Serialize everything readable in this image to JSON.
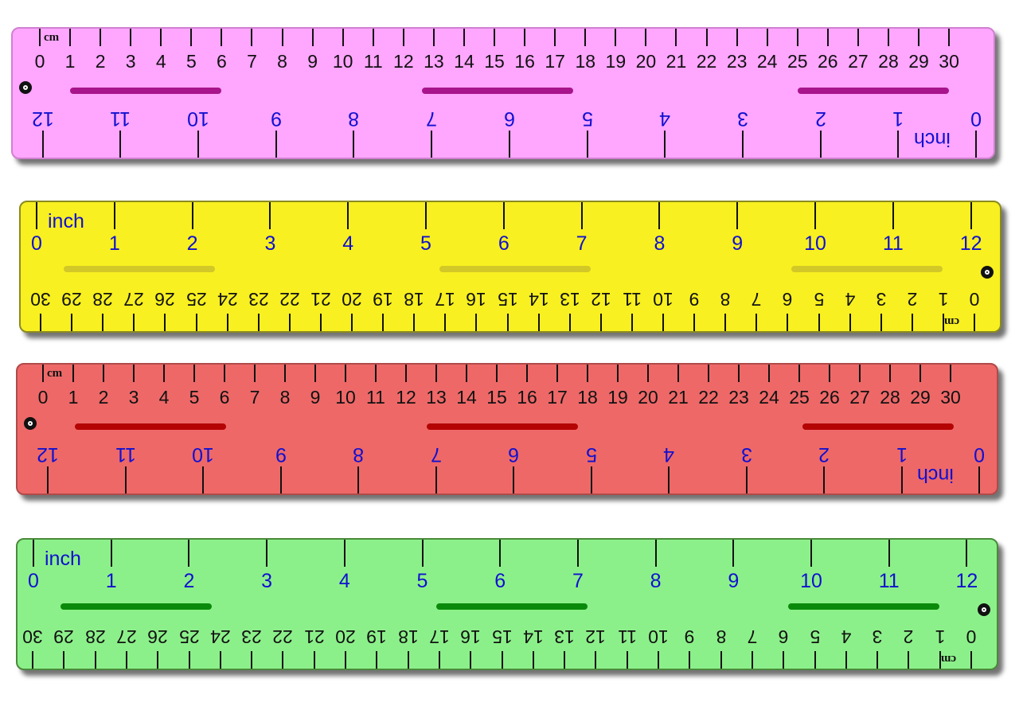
{
  "rulers": [
    {
      "name": "pink-ruler",
      "color": "#ffa6ff",
      "border": "#d080d0",
      "groove_color": "#a8148c",
      "orientation": "cm-top",
      "cm_unit_label": "cm",
      "inch_unit_label": "inch",
      "cm_labels": [
        "0",
        "1",
        "2",
        "3",
        "4",
        "5",
        "6",
        "7",
        "8",
        "9",
        "10",
        "11",
        "12",
        "13",
        "14",
        "15",
        "16",
        "17",
        "18",
        "19",
        "20",
        "21",
        "22",
        "23",
        "24",
        "25",
        "26",
        "27",
        "28",
        "29",
        "30"
      ],
      "inch_labels": [
        "0",
        "1",
        "2",
        "3",
        "4",
        "5",
        "6",
        "7",
        "8",
        "9",
        "10",
        "11",
        "12"
      ]
    },
    {
      "name": "yellow-ruler",
      "color": "#f8f020",
      "border": "#8a8a20",
      "groove_color": "#d2c828",
      "orientation": "inch-top",
      "cm_unit_label": "cm",
      "inch_unit_label": "inch",
      "cm_labels": [
        "0",
        "1",
        "2",
        "3",
        "4",
        "5",
        "6",
        "7",
        "8",
        "9",
        "10",
        "11",
        "12",
        "13",
        "14",
        "15",
        "16",
        "17",
        "18",
        "19",
        "20",
        "21",
        "22",
        "23",
        "24",
        "25",
        "26",
        "27",
        "28",
        "29",
        "30"
      ],
      "inch_labels": [
        "0",
        "1",
        "2",
        "3",
        "4",
        "5",
        "6",
        "7",
        "8",
        "9",
        "10",
        "11",
        "12"
      ]
    },
    {
      "name": "red-ruler",
      "color": "#ee6868",
      "border": "#b04a4a",
      "groove_color": "#b40404",
      "orientation": "cm-top",
      "cm_unit_label": "cm",
      "inch_unit_label": "inch",
      "cm_labels": [
        "0",
        "1",
        "2",
        "3",
        "4",
        "5",
        "6",
        "7",
        "8",
        "9",
        "10",
        "11",
        "12",
        "13",
        "14",
        "15",
        "16",
        "17",
        "18",
        "19",
        "20",
        "21",
        "22",
        "23",
        "24",
        "25",
        "26",
        "27",
        "28",
        "29",
        "30"
      ],
      "inch_labels": [
        "0",
        "1",
        "2",
        "3",
        "4",
        "5",
        "6",
        "7",
        "8",
        "9",
        "10",
        "11",
        "12"
      ]
    },
    {
      "name": "green-ruler",
      "color": "#8cf08a",
      "border": "#4a8a3a",
      "groove_color": "#0a8a0a",
      "orientation": "inch-top",
      "cm_unit_label": "cm",
      "inch_unit_label": "inch",
      "cm_labels": [
        "0",
        "1",
        "2",
        "3",
        "4",
        "5",
        "6",
        "7",
        "8",
        "9",
        "10",
        "11",
        "12",
        "13",
        "14",
        "15",
        "16",
        "17",
        "18",
        "19",
        "20",
        "21",
        "22",
        "23",
        "24",
        "25",
        "26",
        "27",
        "28",
        "29",
        "30"
      ],
      "inch_labels": [
        "0",
        "1",
        "2",
        "3",
        "4",
        "5",
        "6",
        "7",
        "8",
        "9",
        "10",
        "11",
        "12"
      ]
    }
  ],
  "colors": {
    "cm_text": "#111111",
    "inch_text": "#1010d0"
  }
}
